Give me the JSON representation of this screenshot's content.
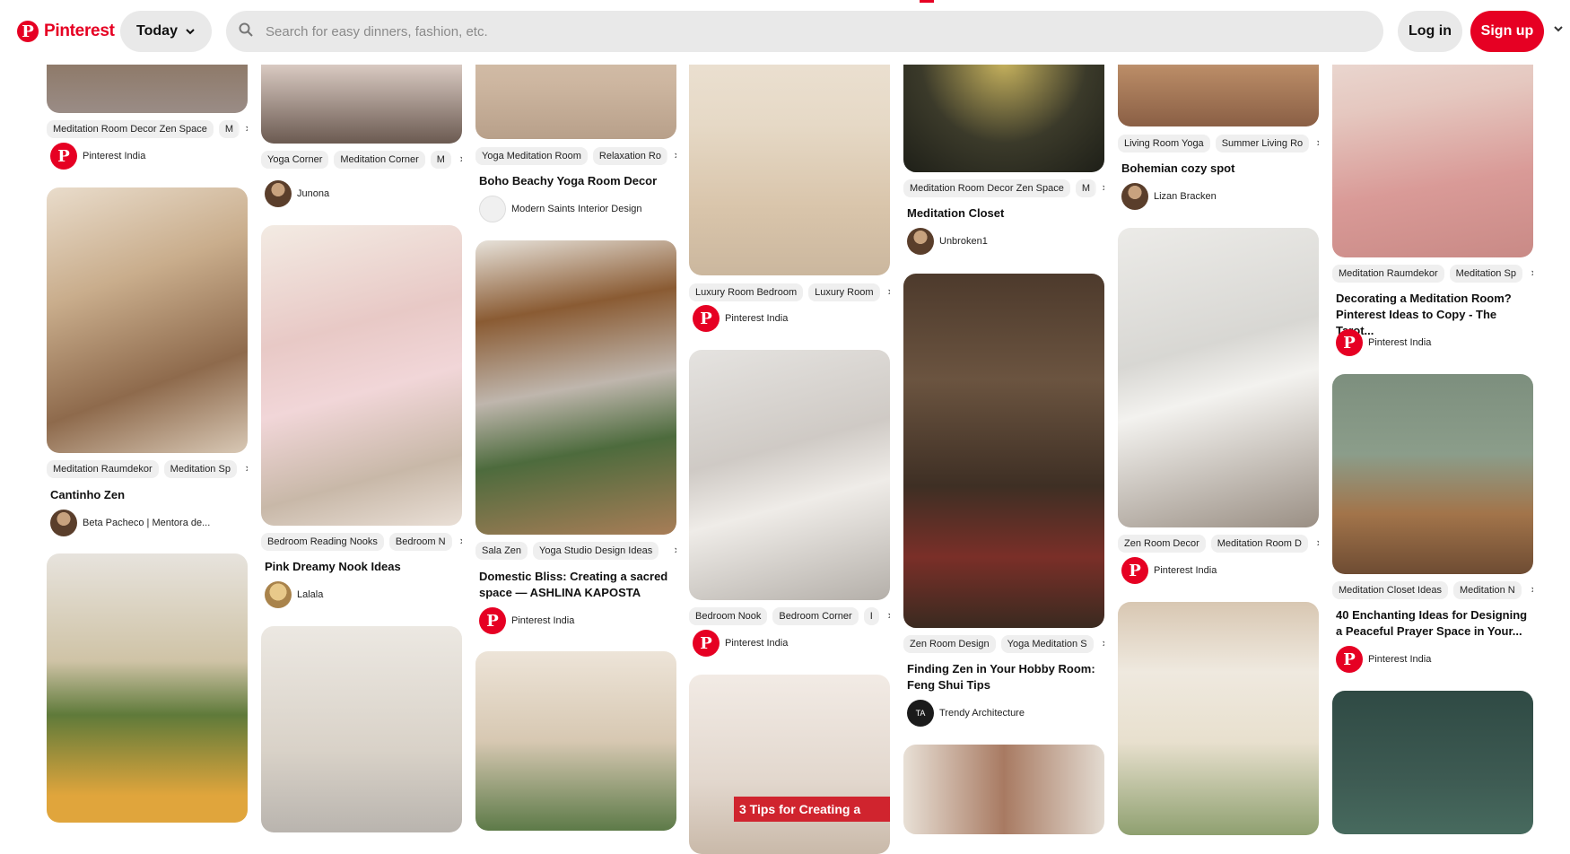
{
  "header": {
    "logo_text": "Pinterest",
    "today_label": "Today",
    "search_placeholder": "Search for easy dinners, fashion, etc.",
    "login_label": "Log in",
    "signup_label": "Sign up"
  },
  "colors": {
    "brand": "#e60023",
    "pill": "#e9e9e9"
  },
  "pins": {
    "c1": [
      {
        "tags": [
          "Meditation Room Decor Zen Space",
          "M"
        ],
        "author": "Pinterest India"
      },
      {
        "tags": [
          "Meditation Raumdekor",
          "Meditation Sp"
        ],
        "title": "Cantinho Zen",
        "author": "Beta Pacheco | Mentora de..."
      },
      {}
    ],
    "c2": [
      {
        "tags": [
          "Yoga Corner",
          "Meditation Corner",
          "M"
        ],
        "author": "Junona"
      },
      {
        "tags": [
          "Bedroom Reading Nooks",
          "Bedroom N"
        ],
        "title": "Pink Dreamy Nook Ideas",
        "author": "Lalala"
      },
      {}
    ],
    "c3": [
      {
        "tags": [
          "Yoga Meditation Room",
          "Relaxation Ro"
        ],
        "title": "Boho Beachy Yoga Room Decor",
        "author": "Modern Saints Interior Design"
      },
      {
        "tags": [
          "Sala Zen",
          "Yoga Studio Design Ideas"
        ],
        "title": "Domestic Bliss: Creating a sacred space — ASHLINA KAPOSTA",
        "author": "Pinterest India"
      },
      {}
    ],
    "c4": [
      {
        "tags": [
          "Luxury Room Bedroom",
          "Luxury Room"
        ],
        "author": "Pinterest India"
      },
      {
        "tags": [
          "Bedroom Nook",
          "Bedroom Corner",
          "I"
        ],
        "author": "Pinterest India"
      },
      {
        "overlay": "3 Tips for Creating a"
      }
    ],
    "c5": [
      {
        "tags": [
          "Meditation Room Decor Zen Space",
          "M"
        ],
        "title": "Meditation Closet",
        "author": "Unbroken1"
      },
      {
        "tags": [
          "Zen Room Design",
          "Yoga Meditation S"
        ],
        "title": "Finding Zen in Your Hobby Room: Feng Shui Tips",
        "author": "Trendy Architecture",
        "author_initials": "TA"
      },
      {}
    ],
    "c6": [
      {
        "tags": [
          "Living Room Yoga",
          "Summer Living Ro"
        ],
        "title": "Bohemian cozy spot",
        "author": "Lizan Bracken"
      },
      {
        "tags": [
          "Zen Room Decor",
          "Meditation Room D"
        ],
        "author": "Pinterest India"
      },
      {}
    ],
    "c7": [
      {
        "tags": [
          "Meditation Raumdekor",
          "Meditation Sp"
        ],
        "title": "Decorating a Meditation Room? Pinterest Ideas to Copy - The Tarot...",
        "author": "Pinterest India"
      },
      {
        "tags": [
          "Meditation Closet Ideas",
          "Meditation N"
        ],
        "title": "40 Enchanting Ideas for Designing a Peaceful Prayer Space in Your...",
        "author": "Pinterest India"
      },
      {}
    ]
  }
}
